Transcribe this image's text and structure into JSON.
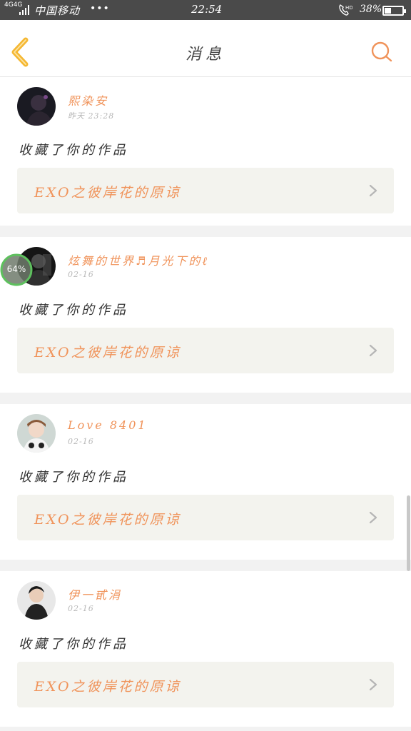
{
  "status_bar": {
    "network": "4G4G",
    "carrier": "中国移动",
    "dots": "•••",
    "time": "22:54",
    "call_icon": "wifi-calling-hd-icon",
    "call_label": "HD",
    "battery_percent_text": "38%",
    "battery_level": 0.38
  },
  "nav": {
    "back_icon": "chevron-left-icon",
    "title": "消息",
    "search_icon": "search-icon",
    "accent_color": "#f0935a"
  },
  "messages": [
    {
      "username": "熙染安",
      "time": "昨天 23:28",
      "action": "收藏了你的作品",
      "work_title": "EXO之彼岸花的原谅"
    },
    {
      "username": "炫舞的世界♬月光下的ℓ",
      "time": "02-16",
      "action": "收藏了你的作品",
      "work_title": "EXO之彼岸花的原谅"
    },
    {
      "username": "Love   8401",
      "time": "02-16",
      "action": "收藏了你的作品",
      "work_title": "EXO之彼岸花的原谅"
    },
    {
      "username": "伊一甙涓",
      "time": "02-16",
      "action": "收藏了你的作品",
      "work_title": "EXO之彼岸花的原谅"
    }
  ],
  "float_widget": {
    "label": "64%"
  },
  "colors": {
    "accent": "#f0935a",
    "back_icon": "#f5b731",
    "status_bar": "#4a4a4a",
    "card_box": "#f3f3ee"
  }
}
